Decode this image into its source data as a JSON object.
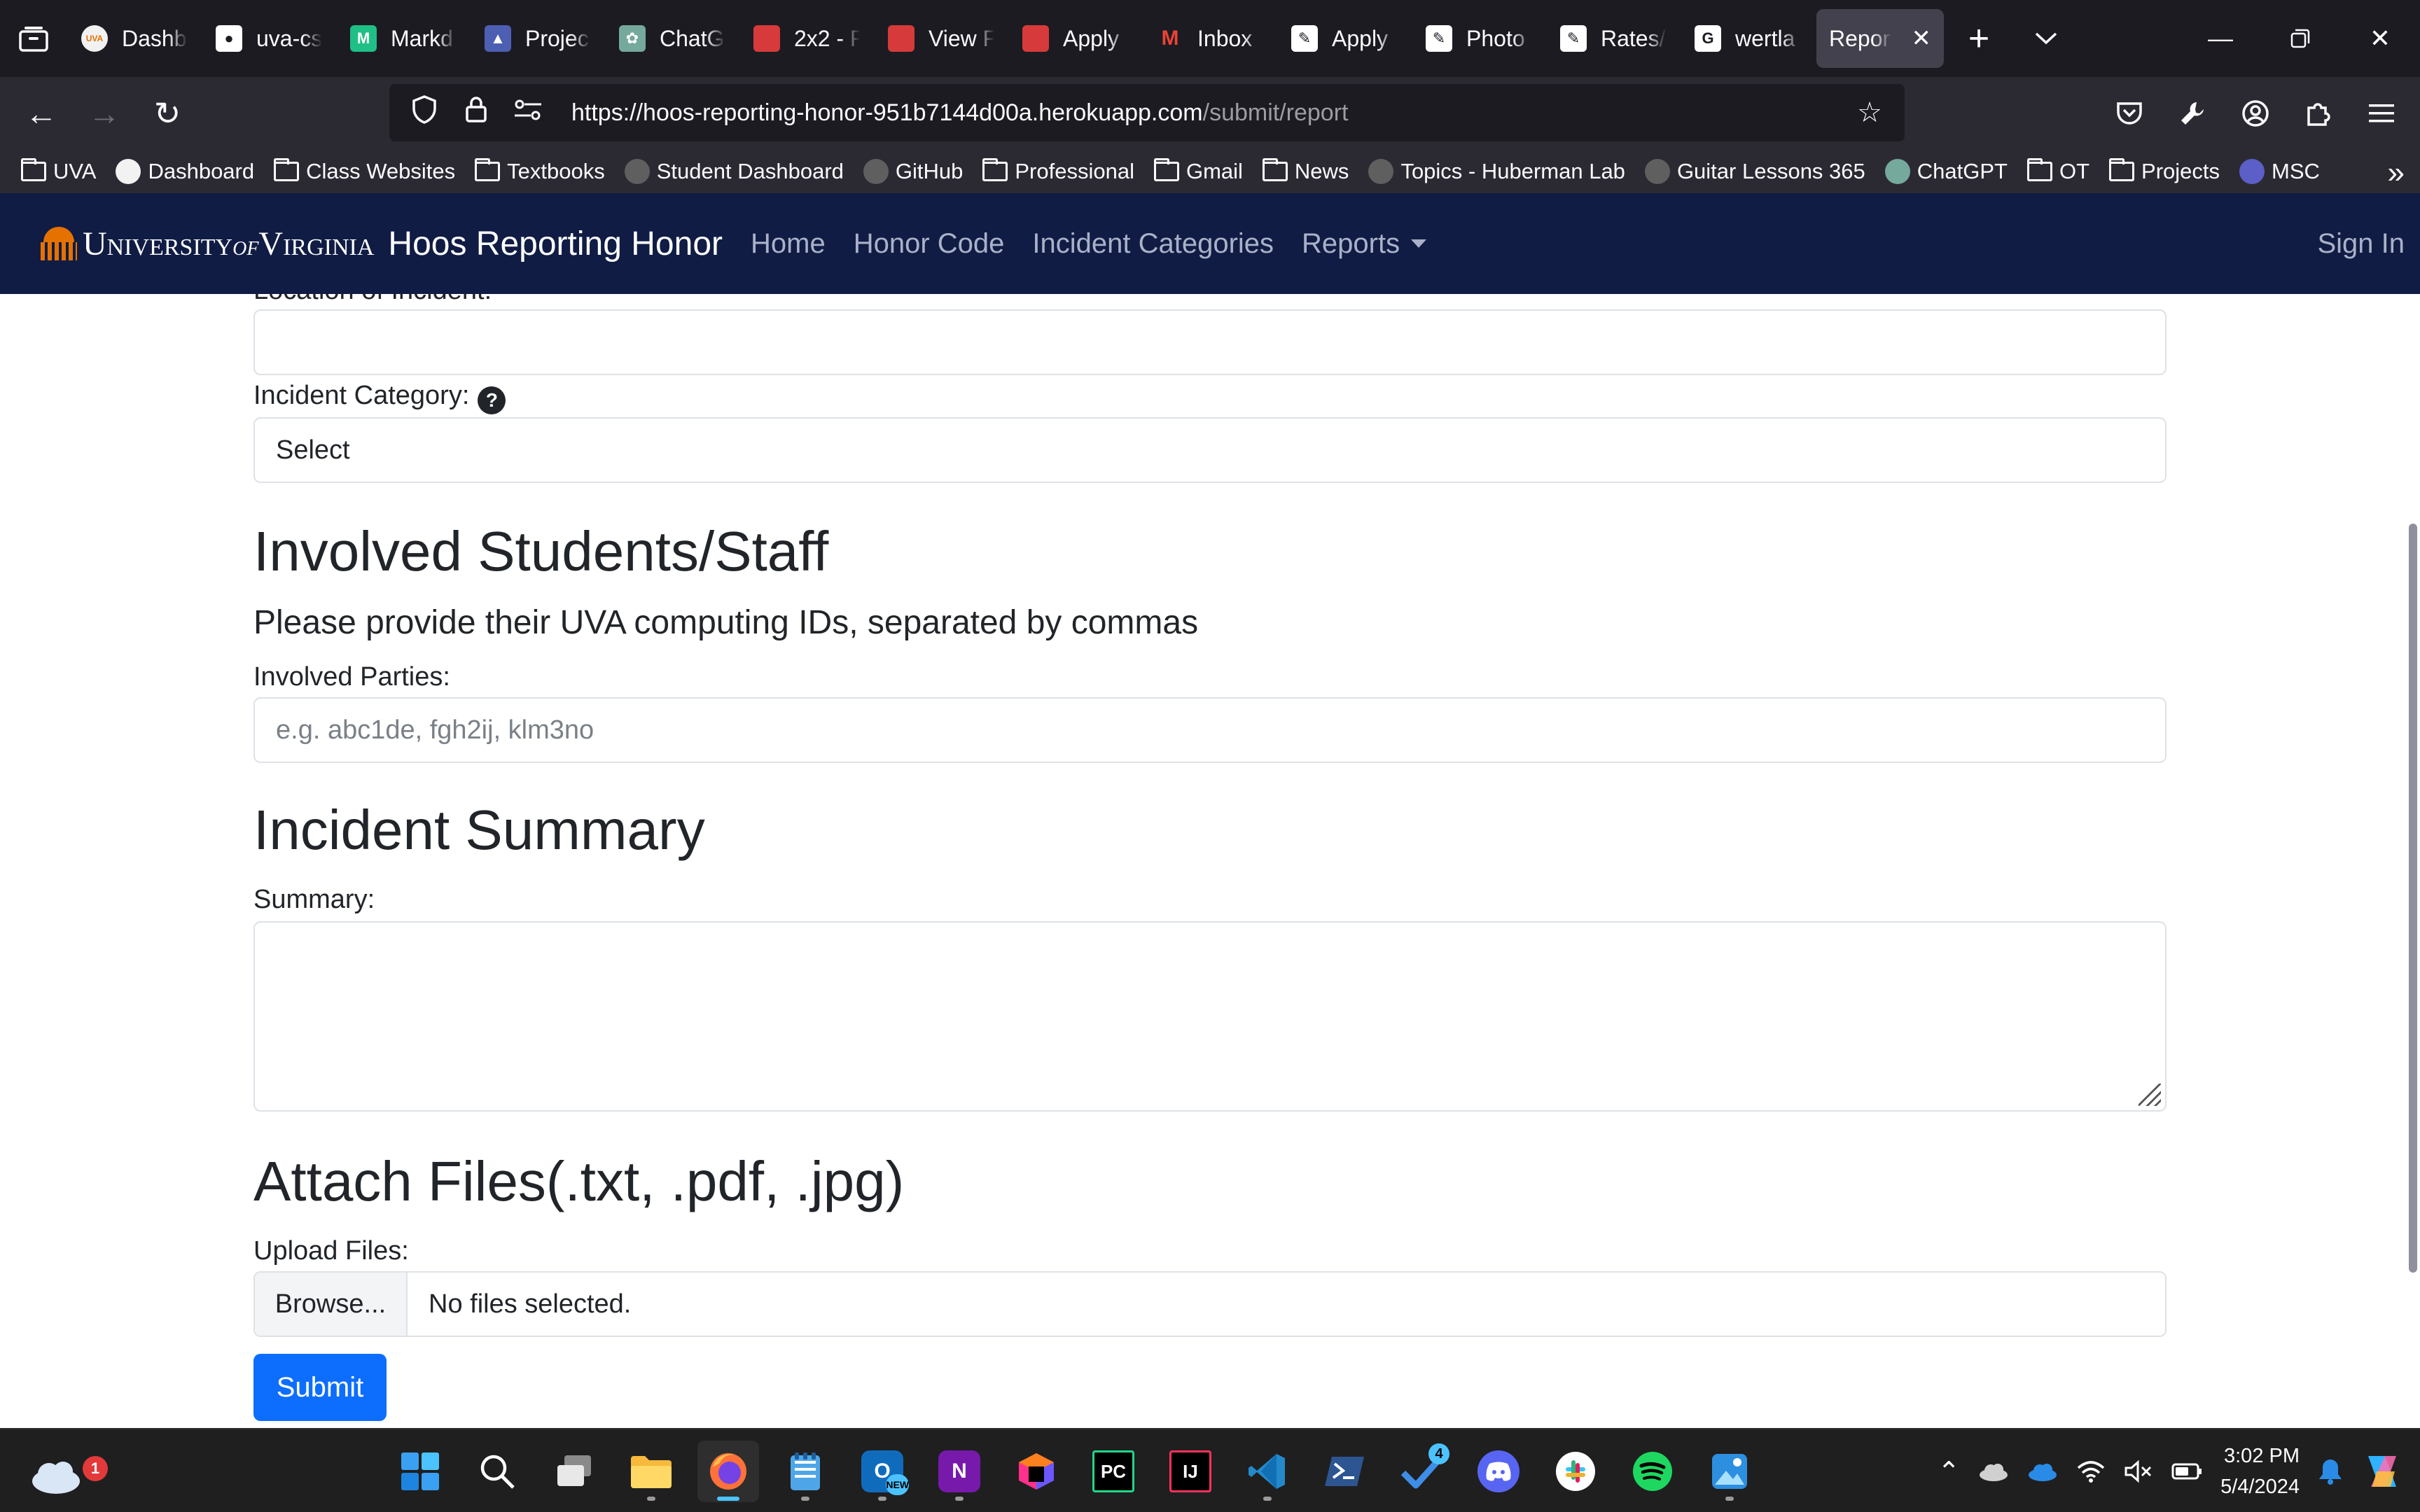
{
  "browser": {
    "tabs": [
      {
        "label": "Dashb",
        "favicon": "uva-icon",
        "color": "#f2f2f2",
        "glyph": "UVA"
      },
      {
        "label": "uva-cs",
        "favicon": "github-icon",
        "color": "#ffffff",
        "glyph": "●"
      },
      {
        "label": "Markd",
        "favicon": "markdown-icon",
        "color": "#1fbf86",
        "glyph": "M"
      },
      {
        "label": "Projec",
        "favicon": "university-icon",
        "color": "#4d5fb3",
        "glyph": "▲"
      },
      {
        "label": "ChatG",
        "favicon": "chatgpt-icon",
        "color": "#75a99c",
        "glyph": "✿"
      },
      {
        "label": "2x2 - F",
        "favicon": "red-square-icon",
        "color": "#d73a3a",
        "glyph": ""
      },
      {
        "label": "View F",
        "favicon": "red-square-icon",
        "color": "#d73a3a",
        "glyph": ""
      },
      {
        "label": "Apply",
        "favicon": "red-square-icon",
        "color": "#d73a3a",
        "glyph": ""
      },
      {
        "label": "Inbox",
        "favicon": "gmail-icon",
        "color": "#1c1b22",
        "glyph": "M"
      },
      {
        "label": "Apply",
        "favicon": "pen-icon",
        "color": "#ffffff",
        "glyph": "✎"
      },
      {
        "label": "Photo",
        "favicon": "pen-icon",
        "color": "#ffffff",
        "glyph": "✎"
      },
      {
        "label": "Rates/",
        "favicon": "pen-icon",
        "color": "#ffffff",
        "glyph": "✎"
      },
      {
        "label": "wertla",
        "favicon": "google-icon",
        "color": "#ffffff",
        "glyph": "G"
      }
    ],
    "active_tab": {
      "label": "Report"
    },
    "url_host": "https://hoos-reporting-honor-951b7144d00a.herokuapp.com",
    "url_path": "/submit/report",
    "bookmarks": [
      {
        "label": "UVA",
        "type": "folder"
      },
      {
        "label": "Dashboard",
        "type": "site"
      },
      {
        "label": "Class Websites",
        "type": "folder"
      },
      {
        "label": "Textbooks",
        "type": "folder"
      },
      {
        "label": "Student Dashboard",
        "type": "site"
      },
      {
        "label": "GitHub",
        "type": "site"
      },
      {
        "label": "Professional",
        "type": "folder"
      },
      {
        "label": "Gmail",
        "type": "folder"
      },
      {
        "label": "News",
        "type": "folder"
      },
      {
        "label": "Topics - Huberman Lab",
        "type": "site"
      },
      {
        "label": "Guitar Lessons 365",
        "type": "site"
      },
      {
        "label": "ChatGPT",
        "type": "site"
      },
      {
        "label": "OT",
        "type": "folder"
      },
      {
        "label": "Projects",
        "type": "folder"
      },
      {
        "label": "MSC",
        "type": "site"
      }
    ]
  },
  "site": {
    "logo_university": "University",
    "logo_of": "of",
    "logo_virginia": "Virginia",
    "brand": "Hoos Reporting Honor",
    "nav": [
      "Home",
      "Honor Code",
      "Incident Categories",
      "Reports"
    ],
    "signin": "Sign In",
    "brand_color": "#101c44"
  },
  "form": {
    "location_label": "Location of Incident:",
    "location_value": "",
    "category_label": "Incident Category:",
    "category_selected": "Select",
    "students_heading": "Involved Students/Staff",
    "students_lead": "Please provide their UVA computing IDs, separated by commas",
    "parties_label": "Involved Parties:",
    "parties_placeholder": "e.g. abc1de, fgh2ij, klm3no",
    "summary_heading": "Incident Summary",
    "summary_label": "Summary:",
    "files_heading": "Attach Files(.txt, .pdf, .jpg)",
    "upload_label": "Upload Files:",
    "browse_label": "Browse...",
    "file_status": "No files selected.",
    "submit_label": "Submit",
    "submit_color": "#0d6efd"
  },
  "taskbar": {
    "weather_badge": "1",
    "outlook_badge": "NEW",
    "todo_badge": "4",
    "time": "3:02 PM",
    "date": "5/4/2024"
  }
}
